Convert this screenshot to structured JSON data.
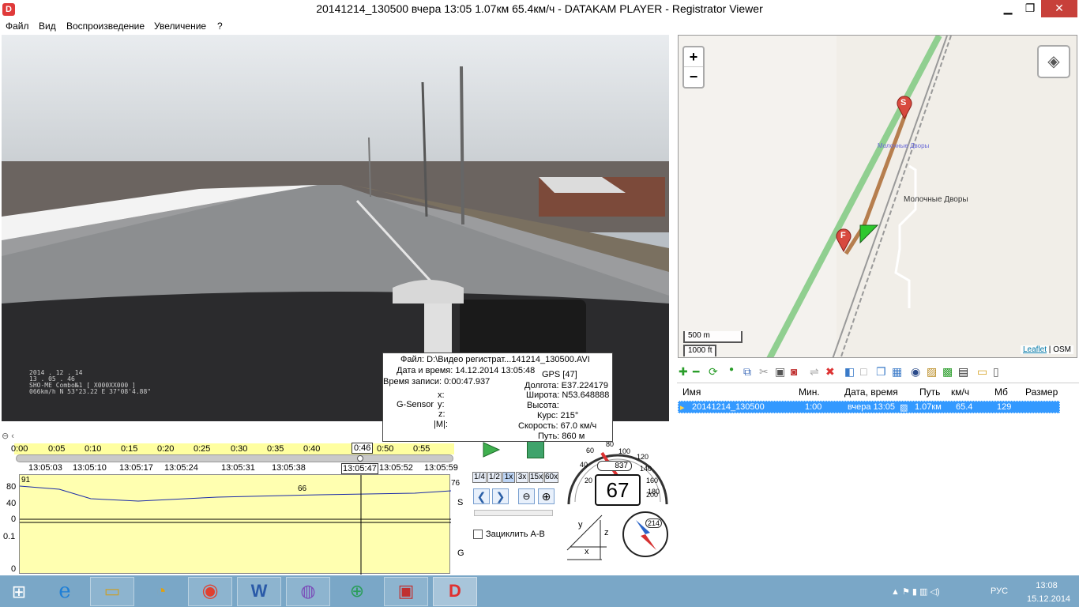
{
  "titlebar": {
    "title": "20141214_130500    вчера 13:05    1.07км    65.4км/ч   -  DATAKAM PLAYER - Registrator Viewer",
    "icon": "D",
    "minimize": "▁",
    "maximize": "❐",
    "close": "✕"
  },
  "menu": [
    "Файл",
    "Вид",
    "Воспроизведение",
    "Увеличение",
    "?"
  ],
  "video_overlay": {
    "date": "2014 . 12 . 14",
    "time": "13 . 05 . 46",
    "model": "SHO-ME Combo№1   [ X000XX000 ]",
    "coords": "066km/h  N 53°23.22  E 37°08'4.88\""
  },
  "info_popup": {
    "file": "Файл: D:\\Видео регистрат...141214_130500.AVI",
    "datetime": "Дата и время: 14.12.2014 13:05:48",
    "record_time": "Время записи: 0:00:47.937",
    "gps": "GPS [47]",
    "longitude": "Долгота: E37.224179",
    "latitude": "Широта: N53.648888",
    "altitude": "Высота:",
    "course": "Курс: 215°",
    "speed": "Скорость: 67.0 км/ч",
    "path": "Путь: 860 м",
    "gsensor": "G-Sensor",
    "x": "x:",
    "y": "y:",
    "z": "z:",
    "m": "|M|:"
  },
  "timeline": {
    "ruler": [
      "0:00",
      "0:05",
      "0:10",
      "0:15",
      "0:20",
      "0:25",
      "0:30",
      "0:35",
      "0:40",
      "0:46",
      "0:50",
      "0:55"
    ],
    "current": "0:46",
    "times": [
      "13:05:03",
      "13:05:10",
      "13:05:17",
      "13:05:24",
      "13:05:31",
      "13:05:38",
      "13:05:47",
      "13:05:52",
      "13:05:59"
    ],
    "current_time": "13:05:47"
  },
  "graph": {
    "y_speed": [
      "80",
      "40",
      "0"
    ],
    "y_g": [
      "0.1",
      "0"
    ],
    "label_s": "S",
    "label_g": "G",
    "val_start": "91",
    "val_mid": "66",
    "val_end": "76"
  },
  "playback": {
    "speeds": [
      "1/4",
      "1/2",
      "1x",
      "3x",
      "15x",
      "60x"
    ],
    "loop_label": "Зациклить A-B"
  },
  "speedometer": {
    "speed": "67",
    "odometer": "837",
    "ticks": [
      "20",
      "40",
      "60",
      "80",
      "100",
      "120",
      "140",
      "160",
      "180",
      "200"
    ]
  },
  "compass": {
    "course": "214"
  },
  "gsensor_axes": {
    "y": "y",
    "z": "z",
    "x": "x"
  },
  "map": {
    "zoom_in": "+",
    "zoom_out": "−",
    "village1": "Молочные Дворы",
    "village2": "Молочные Дворы",
    "scale_m": "500 m",
    "scale_ft": "1000 ft",
    "attribution_leaflet": "Leaflet",
    "attribution_sep": " | ",
    "attribution_osm": "OSM",
    "start": "S",
    "finish": "F"
  },
  "filelist": {
    "headers": [
      "Имя",
      "Мин.",
      "Дата, время",
      "Путь",
      "км/ч",
      "Мб",
      "Размер"
    ],
    "rows": [
      {
        "name": "20141214_130500",
        "min": "1:00",
        "date": "вчера 13:05",
        "path": "1.07км",
        "speed": "65.4",
        "mb": "129",
        "size": ""
      }
    ]
  },
  "taskbar": {
    "time": "13:08",
    "date": "15.12.2014",
    "lang": "РУС"
  }
}
